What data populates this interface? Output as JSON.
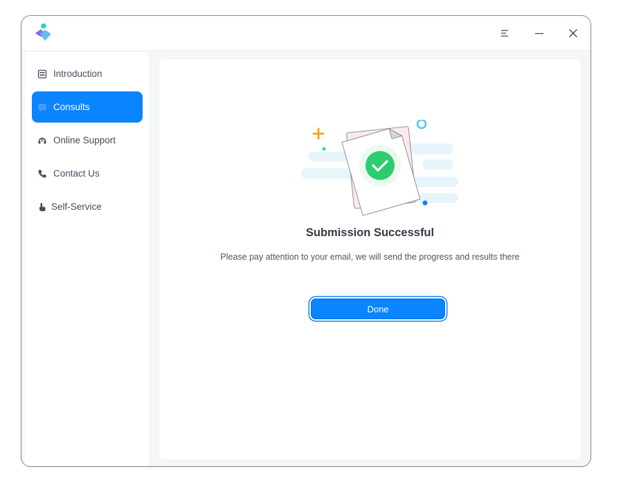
{
  "window": {
    "controls": {
      "menu_icon": "menu-icon",
      "minimize_icon": "minimize-icon",
      "close_icon": "close-icon"
    }
  },
  "sidebar": {
    "items": [
      {
        "label": "Introduction",
        "icon": "document-icon",
        "active": false
      },
      {
        "label": "Consults",
        "icon": "chat-icon",
        "active": true
      },
      {
        "label": "Online Support",
        "icon": "headset-icon",
        "active": false
      },
      {
        "label": "Contact Us",
        "icon": "phone-icon",
        "active": false
      },
      {
        "label": "Self-Service",
        "icon": "hand-pointer-icon",
        "active": false
      }
    ]
  },
  "main": {
    "title": "Submission Successful",
    "message": "Please pay attention to your email, we will send the progress and results there",
    "done_label": "Done",
    "illustration_icon": "success-checkmark-icon"
  },
  "colors": {
    "accent": "#0a84ff",
    "success": "#2ecc71",
    "sidebar_bg": "#ffffff",
    "window_bg": "#f5f6f7"
  }
}
